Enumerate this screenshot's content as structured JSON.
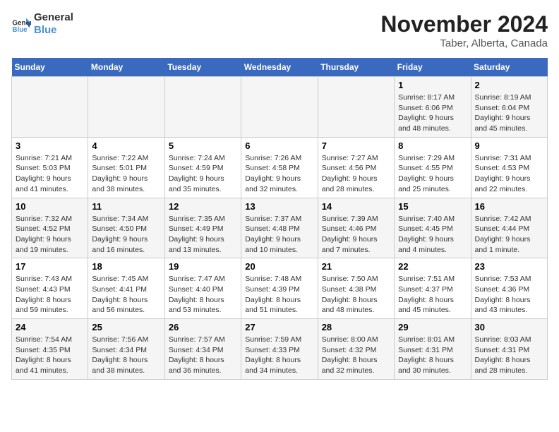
{
  "header": {
    "logo_line1": "General",
    "logo_line2": "Blue",
    "month": "November 2024",
    "location": "Taber, Alberta, Canada"
  },
  "weekdays": [
    "Sunday",
    "Monday",
    "Tuesday",
    "Wednesday",
    "Thursday",
    "Friday",
    "Saturday"
  ],
  "weeks": [
    [
      {
        "day": "",
        "info": ""
      },
      {
        "day": "",
        "info": ""
      },
      {
        "day": "",
        "info": ""
      },
      {
        "day": "",
        "info": ""
      },
      {
        "day": "",
        "info": ""
      },
      {
        "day": "1",
        "info": "Sunrise: 8:17 AM\nSunset: 6:06 PM\nDaylight: 9 hours and 48 minutes."
      },
      {
        "day": "2",
        "info": "Sunrise: 8:19 AM\nSunset: 6:04 PM\nDaylight: 9 hours and 45 minutes."
      }
    ],
    [
      {
        "day": "3",
        "info": "Sunrise: 7:21 AM\nSunset: 5:03 PM\nDaylight: 9 hours and 41 minutes."
      },
      {
        "day": "4",
        "info": "Sunrise: 7:22 AM\nSunset: 5:01 PM\nDaylight: 9 hours and 38 minutes."
      },
      {
        "day": "5",
        "info": "Sunrise: 7:24 AM\nSunset: 4:59 PM\nDaylight: 9 hours and 35 minutes."
      },
      {
        "day": "6",
        "info": "Sunrise: 7:26 AM\nSunset: 4:58 PM\nDaylight: 9 hours and 32 minutes."
      },
      {
        "day": "7",
        "info": "Sunrise: 7:27 AM\nSunset: 4:56 PM\nDaylight: 9 hours and 28 minutes."
      },
      {
        "day": "8",
        "info": "Sunrise: 7:29 AM\nSunset: 4:55 PM\nDaylight: 9 hours and 25 minutes."
      },
      {
        "day": "9",
        "info": "Sunrise: 7:31 AM\nSunset: 4:53 PM\nDaylight: 9 hours and 22 minutes."
      }
    ],
    [
      {
        "day": "10",
        "info": "Sunrise: 7:32 AM\nSunset: 4:52 PM\nDaylight: 9 hours and 19 minutes."
      },
      {
        "day": "11",
        "info": "Sunrise: 7:34 AM\nSunset: 4:50 PM\nDaylight: 9 hours and 16 minutes."
      },
      {
        "day": "12",
        "info": "Sunrise: 7:35 AM\nSunset: 4:49 PM\nDaylight: 9 hours and 13 minutes."
      },
      {
        "day": "13",
        "info": "Sunrise: 7:37 AM\nSunset: 4:48 PM\nDaylight: 9 hours and 10 minutes."
      },
      {
        "day": "14",
        "info": "Sunrise: 7:39 AM\nSunset: 4:46 PM\nDaylight: 9 hours and 7 minutes."
      },
      {
        "day": "15",
        "info": "Sunrise: 7:40 AM\nSunset: 4:45 PM\nDaylight: 9 hours and 4 minutes."
      },
      {
        "day": "16",
        "info": "Sunrise: 7:42 AM\nSunset: 4:44 PM\nDaylight: 9 hours and 1 minute."
      }
    ],
    [
      {
        "day": "17",
        "info": "Sunrise: 7:43 AM\nSunset: 4:43 PM\nDaylight: 8 hours and 59 minutes."
      },
      {
        "day": "18",
        "info": "Sunrise: 7:45 AM\nSunset: 4:41 PM\nDaylight: 8 hours and 56 minutes."
      },
      {
        "day": "19",
        "info": "Sunrise: 7:47 AM\nSunset: 4:40 PM\nDaylight: 8 hours and 53 minutes."
      },
      {
        "day": "20",
        "info": "Sunrise: 7:48 AM\nSunset: 4:39 PM\nDaylight: 8 hours and 51 minutes."
      },
      {
        "day": "21",
        "info": "Sunrise: 7:50 AM\nSunset: 4:38 PM\nDaylight: 8 hours and 48 minutes."
      },
      {
        "day": "22",
        "info": "Sunrise: 7:51 AM\nSunset: 4:37 PM\nDaylight: 8 hours and 45 minutes."
      },
      {
        "day": "23",
        "info": "Sunrise: 7:53 AM\nSunset: 4:36 PM\nDaylight: 8 hours and 43 minutes."
      }
    ],
    [
      {
        "day": "24",
        "info": "Sunrise: 7:54 AM\nSunset: 4:35 PM\nDaylight: 8 hours and 41 minutes."
      },
      {
        "day": "25",
        "info": "Sunrise: 7:56 AM\nSunset: 4:34 PM\nDaylight: 8 hours and 38 minutes."
      },
      {
        "day": "26",
        "info": "Sunrise: 7:57 AM\nSunset: 4:34 PM\nDaylight: 8 hours and 36 minutes."
      },
      {
        "day": "27",
        "info": "Sunrise: 7:59 AM\nSunset: 4:33 PM\nDaylight: 8 hours and 34 minutes."
      },
      {
        "day": "28",
        "info": "Sunrise: 8:00 AM\nSunset: 4:32 PM\nDaylight: 8 hours and 32 minutes."
      },
      {
        "day": "29",
        "info": "Sunrise: 8:01 AM\nSunset: 4:31 PM\nDaylight: 8 hours and 30 minutes."
      },
      {
        "day": "30",
        "info": "Sunrise: 8:03 AM\nSunset: 4:31 PM\nDaylight: 8 hours and 28 minutes."
      }
    ]
  ]
}
